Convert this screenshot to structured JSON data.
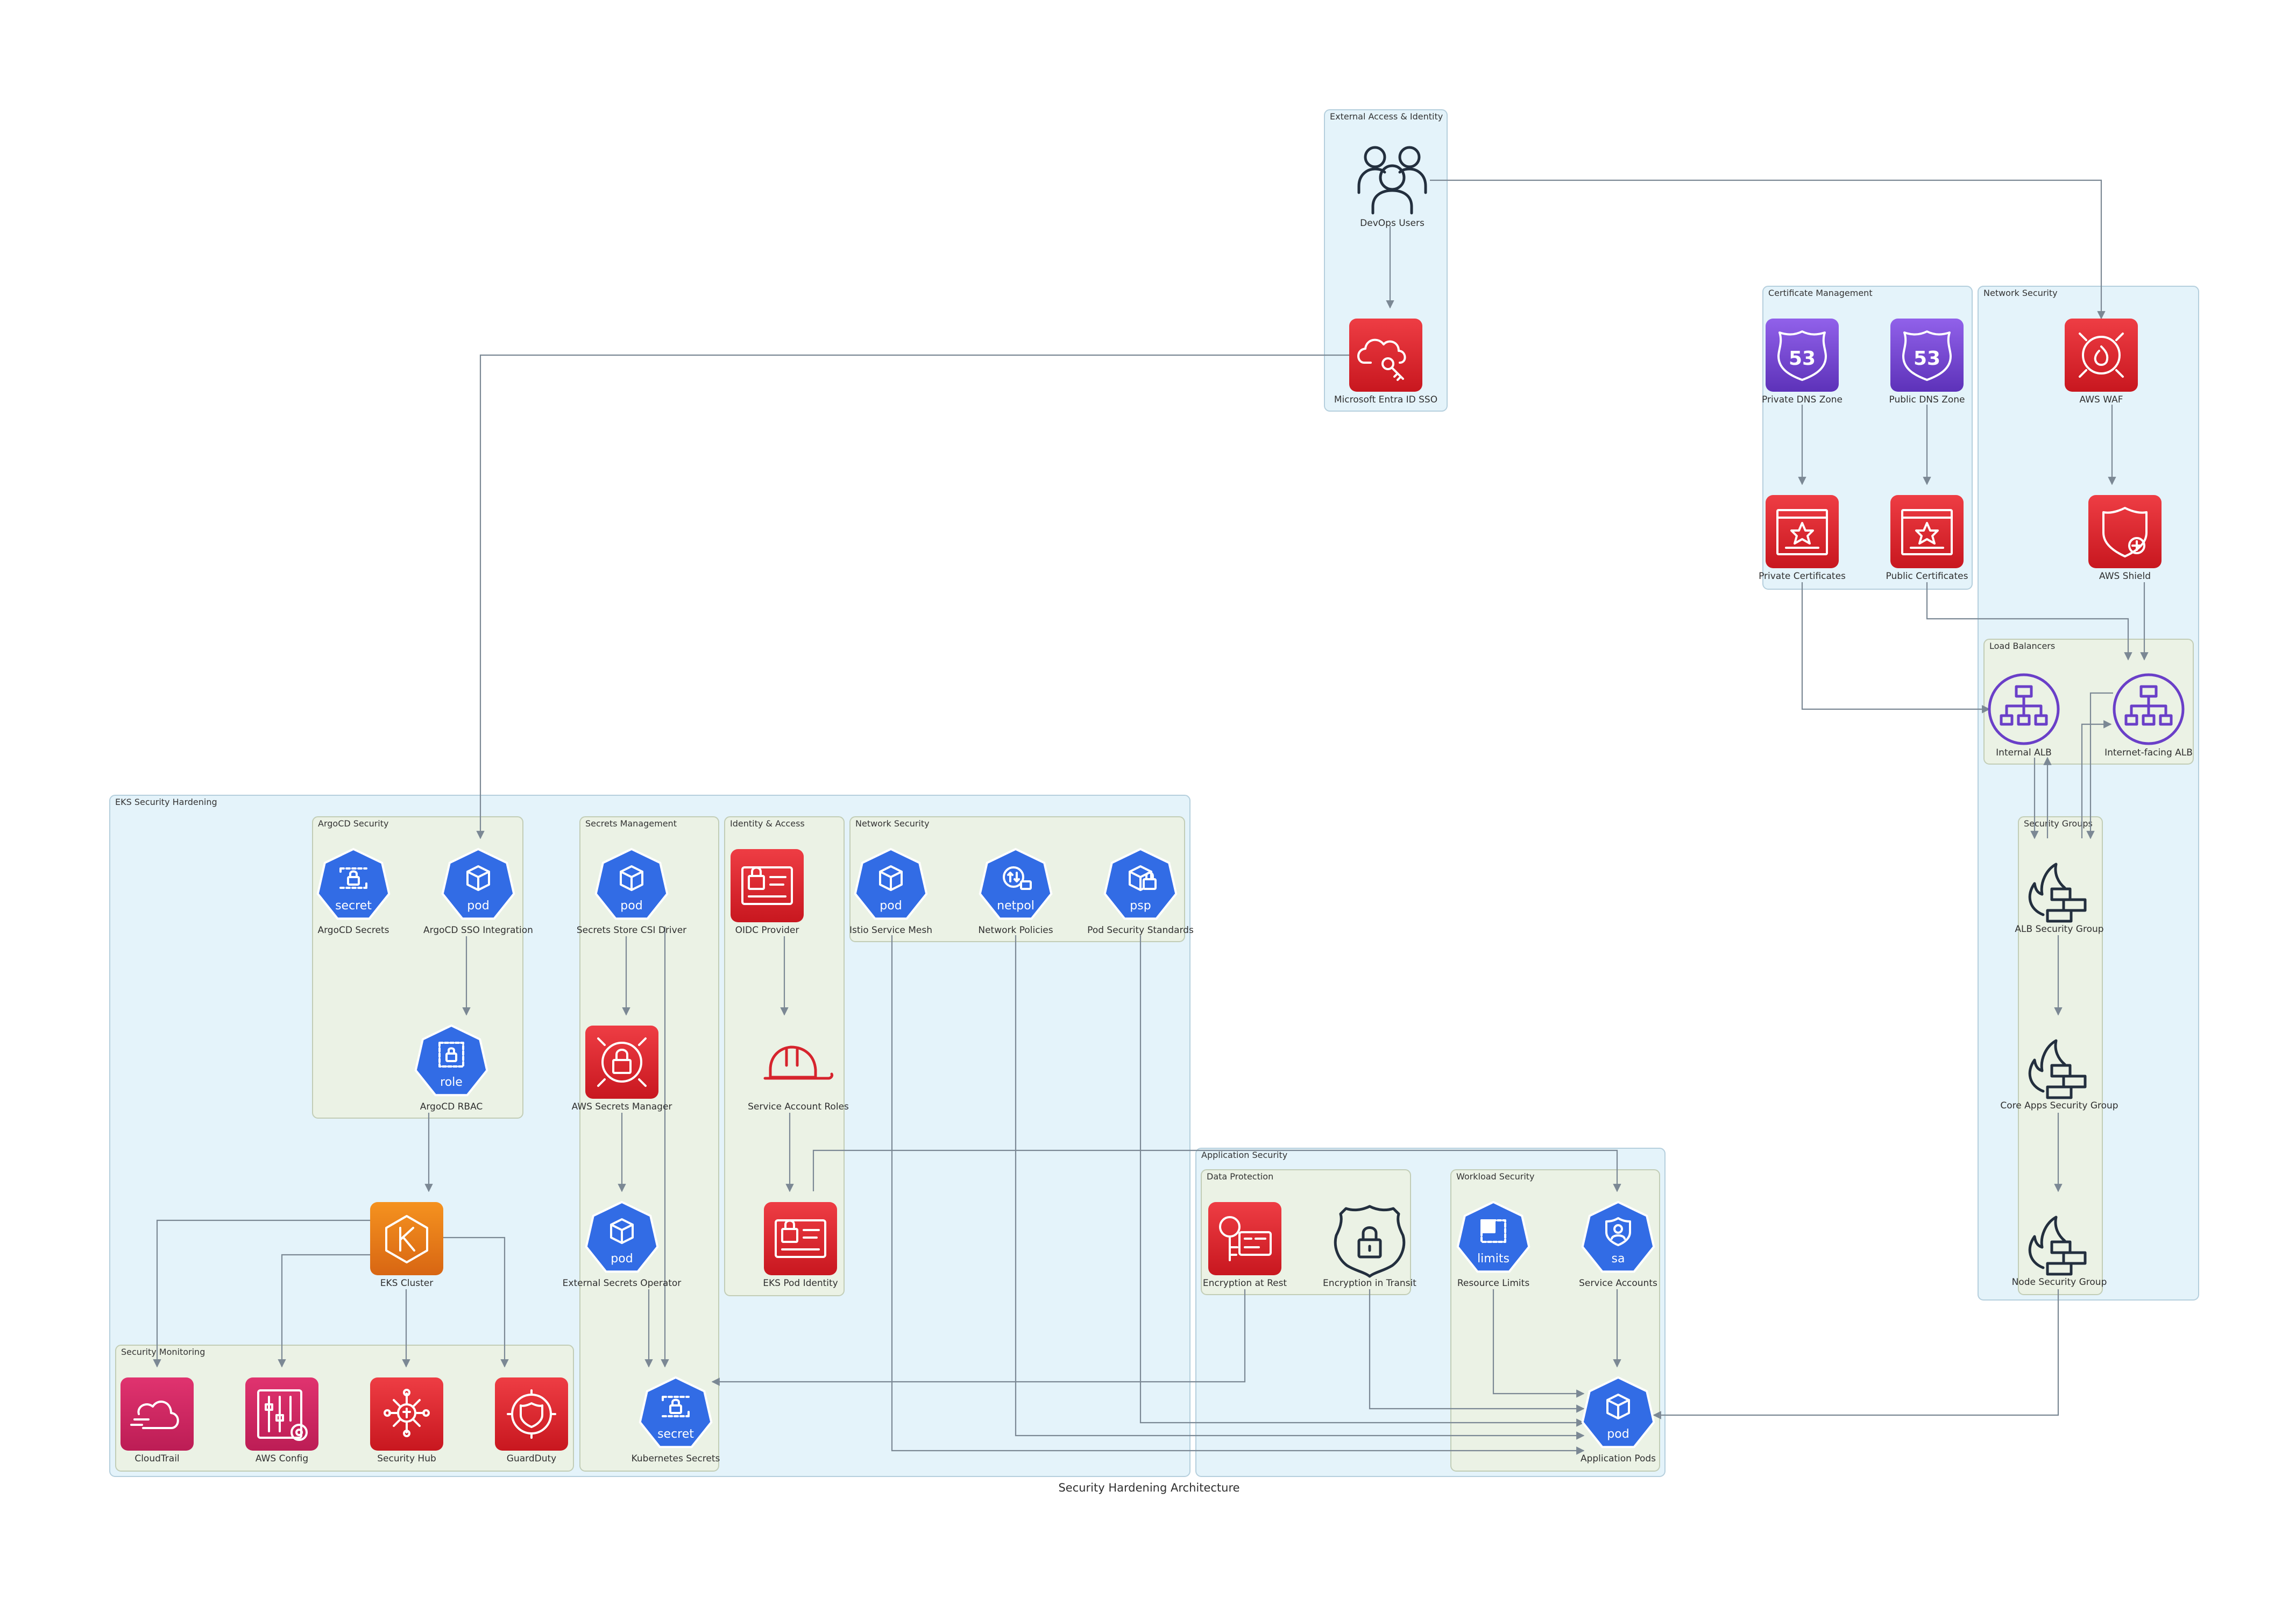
{
  "title": "Security Hardening Architecture",
  "clusters": {
    "external": "External Access & Identity",
    "cert": "Certificate Management",
    "netsec_outer": "Network Security",
    "lb": "Load Balancers",
    "sg": "Security Groups",
    "eks": "EKS Security Hardening",
    "argocd": "ArgoCD Security",
    "secrets": "Secrets Management",
    "identity": "Identity & Access",
    "netsec_inner": "Network Security",
    "monitoring": "Security Monitoring",
    "appsec": "Application Security",
    "dataprot": "Data Protection",
    "workload": "Workload Security"
  },
  "nodes": {
    "devops_users": "DevOps Users",
    "entra_sso": "Microsoft Entra ID SSO",
    "private_dns": "Private DNS Zone",
    "public_dns": "Public DNS Zone",
    "private_certs": "Private Certificates",
    "public_certs": "Public Certificates",
    "aws_waf": "AWS WAF",
    "aws_shield": "AWS Shield",
    "internal_alb": "Internal ALB",
    "internet_alb": "Internet-facing ALB",
    "alb_sg": "ALB Security Group",
    "core_sg": "Core Apps Security Group",
    "node_sg": "Node Security Group",
    "argocd_secrets": "ArgoCD Secrets",
    "argocd_sso": "ArgoCD SSO Integration",
    "argocd_rbac": "ArgoCD RBAC",
    "csi_driver": "Secrets Store CSI Driver",
    "secrets_manager": "AWS Secrets Manager",
    "ext_secrets": "External Secrets Operator",
    "k8s_secrets": "Kubernetes Secrets",
    "oidc": "OIDC Provider",
    "sa_roles": "Service Account Roles",
    "pod_identity": "EKS Pod Identity",
    "istio": "Istio Service Mesh",
    "netpol": "Network Policies",
    "pss": "Pod Security Standards",
    "eks_cluster": "EKS Cluster",
    "cloudtrail": "CloudTrail",
    "aws_config": "AWS Config",
    "security_hub": "Security Hub",
    "guardduty": "GuardDuty",
    "enc_rest": "Encryption at Rest",
    "enc_transit": "Encryption in Transit",
    "resource_limits": "Resource Limits",
    "service_accounts": "Service Accounts",
    "app_pods": "Application Pods"
  },
  "k8s_badges": {
    "argocd_secrets": "secret",
    "argocd_sso": "pod",
    "argocd_rbac": "role",
    "csi_driver": "pod",
    "ext_secrets": "pod",
    "k8s_secrets": "secret",
    "istio": "pod",
    "netpol": "netpol",
    "pss": "psp",
    "resource_limits": "limits",
    "service_accounts": "sa",
    "app_pods": "pod"
  },
  "icons": {
    "devops_users": "users-icon",
    "entra_sso": "cloud-key-icon",
    "dns": "route53-icon",
    "certs": "certificate-icon",
    "aws_waf": "waf-icon",
    "aws_shield": "shield-icon",
    "alb": "load-balancer-icon",
    "security_group": "firewall-icon",
    "eks_cluster": "eks-icon",
    "secrets_manager": "secrets-manager-icon",
    "oidc": "id-card-icon",
    "sa_roles": "hard-hat-icon",
    "cloudtrail": "cloudtrail-icon",
    "aws_config": "config-icon",
    "security_hub": "security-hub-icon",
    "guardduty": "guardduty-icon",
    "enc_rest": "key-icon",
    "enc_transit": "lock-badge-icon",
    "k8s": "kubernetes-hexagon-icon"
  },
  "colors": {
    "k8s_blue": "#326ce5",
    "aws_red": "#d6242d",
    "aws_pink": "#c9285f",
    "route53_purple": "#7b4fd6",
    "eks_orange": "#e8751a",
    "alb_purple": "#6a3fc8",
    "dark_icon": "#232f3e",
    "edge_gray": "#7b8894",
    "cluster_blue": "#e4f3fa",
    "cluster_green": "#ebf2e5"
  }
}
